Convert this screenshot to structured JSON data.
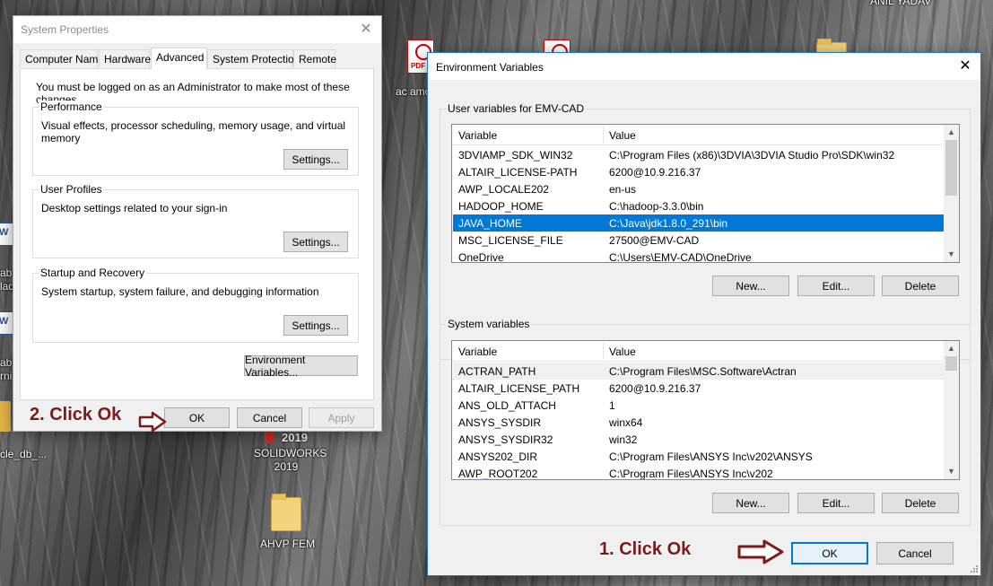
{
  "desktop": {
    "top_right_user": "ANIL YADAV",
    "icons": [
      {
        "label": "ac amc",
        "icon": "pdf-icon"
      },
      {
        "label": "SOLIDWORKS\n2019",
        "icon": "solidworks-icon",
        "badge": "2019"
      },
      {
        "label": "AHVP FEM",
        "icon": "folder-icon"
      },
      {
        "label": "cle_db_...",
        "icon": "file-icon"
      },
      {
        "label": "abv",
        "icon": "word-doc-icon"
      },
      {
        "label": "laq",
        "icon": "word-doc-icon"
      },
      {
        "label": "abv",
        "icon": "word-doc-icon"
      },
      {
        "label": "rni",
        "icon": "word-doc-icon"
      }
    ],
    "pdf_badge": "PDF"
  },
  "system_properties": {
    "title": "System Properties",
    "tabs": [
      "Computer Name",
      "Hardware",
      "Advanced",
      "System Protection",
      "Remote"
    ],
    "active_tab": "Advanced",
    "admin_note": "You must be logged on as an Administrator to make most of these changes.",
    "performance": {
      "label": "Performance",
      "desc": "Visual effects, processor scheduling, memory usage, and virtual memory",
      "button": "Settings..."
    },
    "user_profiles": {
      "label": "User Profiles",
      "desc": "Desktop settings related to your sign-in",
      "button": "Settings..."
    },
    "startup_recovery": {
      "label": "Startup and Recovery",
      "desc": "System startup, system failure, and debugging information",
      "button": "Settings..."
    },
    "env_button": "Environment Variables...",
    "ok": "OK",
    "cancel": "Cancel",
    "apply": "Apply"
  },
  "environment_variables": {
    "title": "Environment Variables",
    "user_group_label": "User variables for EMV-CAD",
    "system_group_label": "System variables",
    "col_variable": "Variable",
    "col_value": "Value",
    "user_rows": [
      {
        "name": "3DVIAMP_SDK_WIN32",
        "value": "C:\\Program Files (x86)\\3DVIA\\3DVIA Studio Pro\\SDK\\win32"
      },
      {
        "name": "ALTAIR_LICENSE-PATH",
        "value": "6200@10.9.216.37"
      },
      {
        "name": "AWP_LOCALE202",
        "value": "en-us"
      },
      {
        "name": "HADOOP_HOME",
        "value": "C:\\hadoop-3.3.0\\bin"
      },
      {
        "name": "JAVA_HOME",
        "value": "C:\\Java\\jdk1.8.0_291\\bin"
      },
      {
        "name": "MSC_LICENSE_FILE",
        "value": "27500@EMV-CAD"
      },
      {
        "name": "OneDrive",
        "value": "C:\\Users\\EMV-CAD\\OneDrive"
      }
    ],
    "user_selected": "JAVA_HOME",
    "system_rows": [
      {
        "name": "ACTRAN_PATH",
        "value": "C:\\Program Files\\MSC.Software\\Actran"
      },
      {
        "name": "ALTAIR_LICENSE_PATH",
        "value": "6200@10.9.216.37"
      },
      {
        "name": "ANS_OLD_ATTACH",
        "value": "1"
      },
      {
        "name": "ANSYS_SYSDIR",
        "value": "winx64"
      },
      {
        "name": "ANSYS_SYSDIR32",
        "value": "win32"
      },
      {
        "name": "ANSYS202_DIR",
        "value": "C:\\Program Files\\ANSYS Inc\\v202\\ANSYS"
      },
      {
        "name": "AWP_ROOT202",
        "value": "C:\\Program Files\\ANSYS Inc\\v202"
      }
    ],
    "new_button": "New...",
    "edit_button": "Edit...",
    "delete_button": "Delete",
    "ok": "OK",
    "cancel": "Cancel"
  },
  "annotations": {
    "step1": "1.  Click Ok",
    "step2": "2.  Click Ok"
  },
  "colors": {
    "selection": "#0078d7",
    "annotation": "#7a1a1a",
    "window_border": "#1979ca"
  }
}
